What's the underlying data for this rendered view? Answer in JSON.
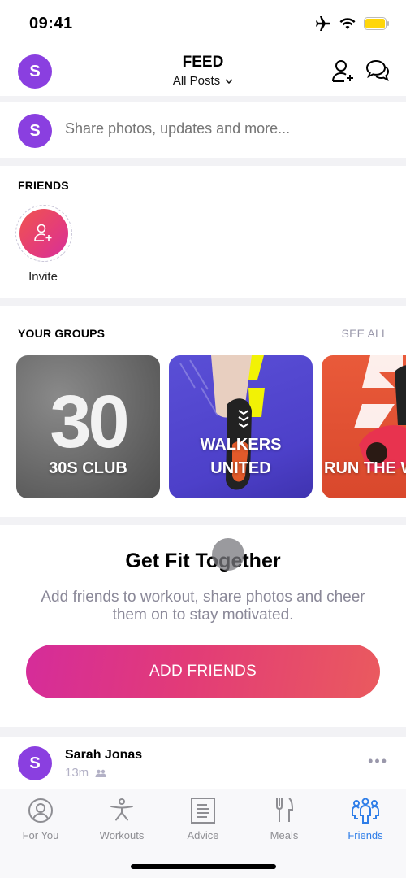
{
  "status_bar": {
    "time": "09:41",
    "battery_color": "#ffd60a"
  },
  "header": {
    "avatar_initial": "S",
    "title": "FEED",
    "filter_label": "All Posts",
    "icons": [
      "add-friend-icon",
      "messages-icon"
    ]
  },
  "composer": {
    "avatar_initial": "S",
    "placeholder": "Share photos, updates and more..."
  },
  "friends": {
    "title": "FRIENDS",
    "invite_label": "Invite"
  },
  "groups": {
    "title": "YOUR GROUPS",
    "see_all_label": "SEE ALL",
    "items": [
      {
        "badge": "30",
        "name": "30S CLUB"
      },
      {
        "name_line1": "WALKERS",
        "name_line2": "UNITED"
      },
      {
        "name": "RUN THE W"
      }
    ]
  },
  "promo": {
    "title": "Get Fit Together",
    "description": "Add friends to workout, share photos and cheer them on to stay motivated.",
    "button_label": "ADD FRIENDS"
  },
  "post": {
    "avatar_initial": "S",
    "author": "Sarah Jonas",
    "time": "13m",
    "more_label": "•••"
  },
  "tabs": [
    {
      "label": "For You",
      "icon": "profile-circle-icon",
      "active": false
    },
    {
      "label": "Workouts",
      "icon": "workout-figure-icon",
      "active": false
    },
    {
      "label": "Advice",
      "icon": "document-icon",
      "active": false
    },
    {
      "label": "Meals",
      "icon": "fork-knife-icon",
      "active": false
    },
    {
      "label": "Friends",
      "icon": "friends-group-icon",
      "active": true
    }
  ],
  "colors": {
    "brand_purple": "#8a3fe0",
    "active_tab": "#2f7ee8",
    "button_gradient_start": "#d52c9a",
    "button_gradient_end": "#ea5a5e"
  }
}
